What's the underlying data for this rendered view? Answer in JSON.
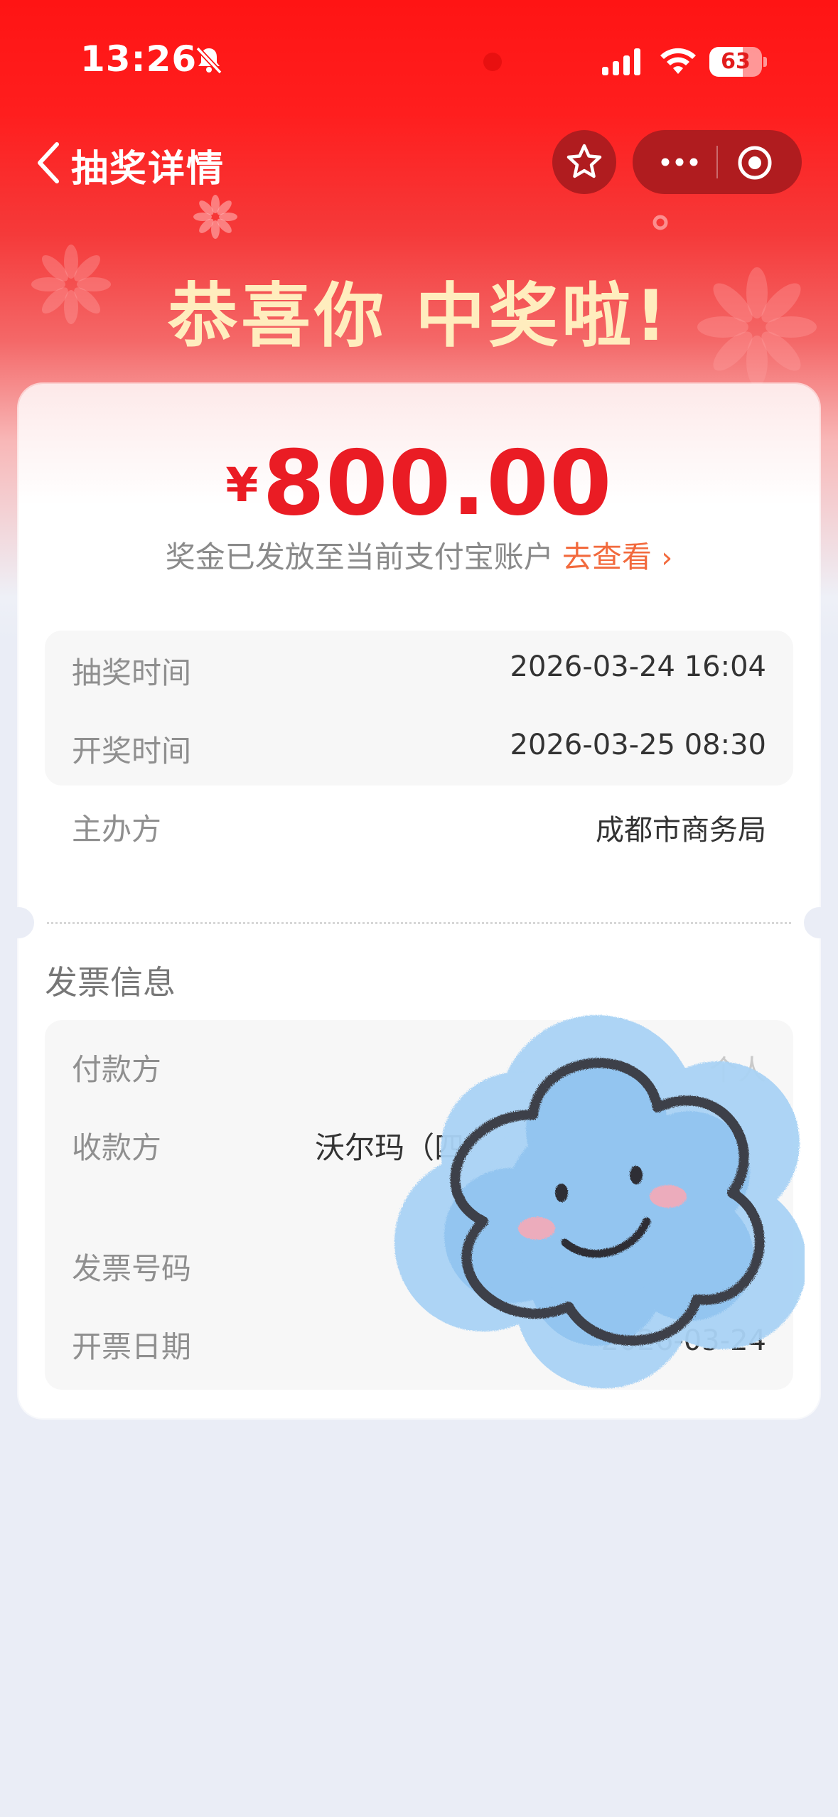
{
  "status_bar": {
    "time": "13:26",
    "battery": "63",
    "battery_level_percent": 63
  },
  "nav": {
    "title": "抽奖详情",
    "back_icon": "chevron-left-icon",
    "favorite_icon": "star-icon",
    "more_icon": "ellipsis-icon",
    "close_icon": "target-icon"
  },
  "hero": {
    "headline": "恭喜你 中奖啦!"
  },
  "prize": {
    "currency": "¥",
    "amount": "800.00",
    "note": "奖金已发放至当前支付宝账户",
    "link": "去查看",
    "link_chevron": "›"
  },
  "lottery_info": [
    {
      "label": "抽奖时间",
      "value": "2026-03-24 16:04"
    },
    {
      "label": "开奖时间",
      "value": "2026-03-25 08:30"
    },
    {
      "label": "主办方",
      "value": "成都市商务局"
    }
  ],
  "invoice": {
    "title": "发票信息",
    "rows": [
      {
        "label": "付款方",
        "value": "个人"
      },
      {
        "label": "收款方",
        "value": "沃尔玛（四"
      },
      {
        "label": "发票号码",
        "value": ""
      },
      {
        "label": "开票日期",
        "value": "2026-03-24"
      }
    ]
  },
  "colors": {
    "brand_red": "#ff1414",
    "amount_red": "#ea1c24",
    "link_orange": "#f26a3d",
    "headline_cream": "#ffedbe",
    "page_bg": "#eaedf6"
  },
  "sticker": {
    "icon": "smiling-cloud-sticker-icon"
  }
}
